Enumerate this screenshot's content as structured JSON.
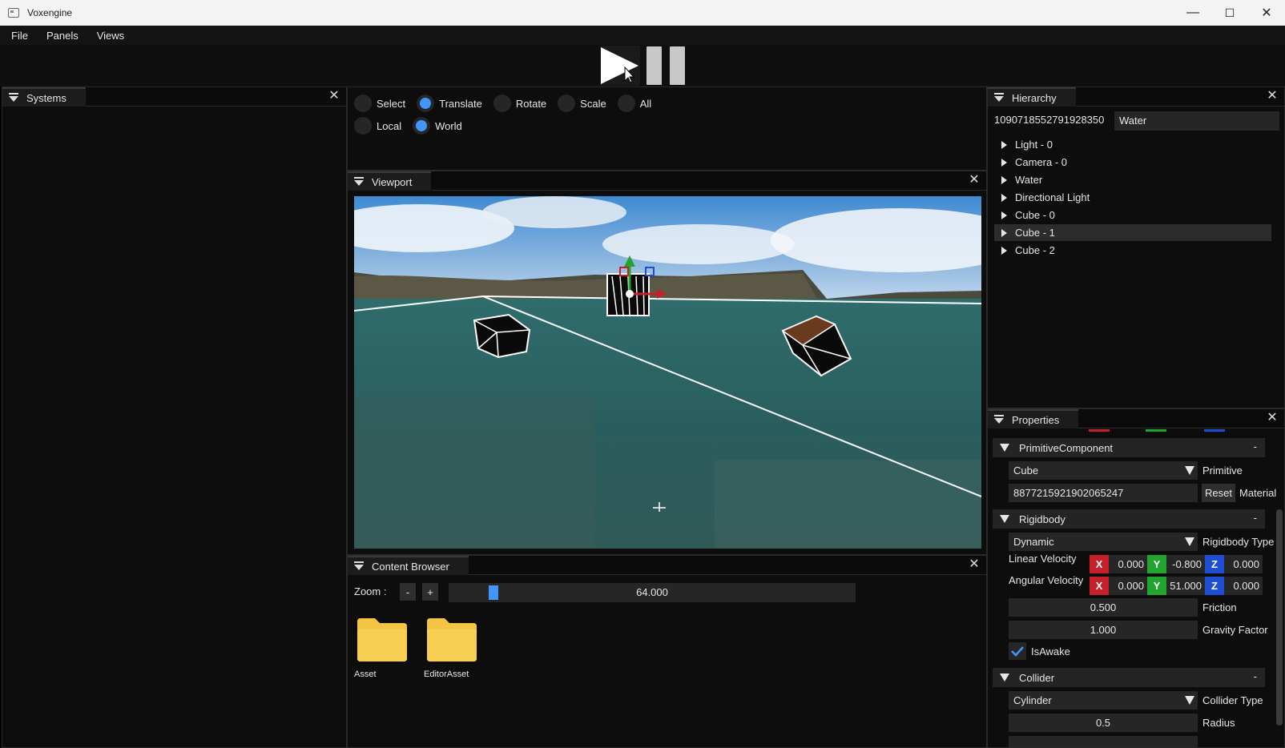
{
  "window": {
    "title": "Voxengine",
    "minimize": "—",
    "maximize": "☐",
    "close": "✕"
  },
  "menu": [
    "File",
    "Panels",
    "Views"
  ],
  "panels": {
    "systems": {
      "title": "Systems"
    },
    "viewport": {
      "title": "Viewport"
    },
    "hierarchy": {
      "title": "Hierarchy"
    },
    "properties": {
      "title": "Properties"
    },
    "content_browser": {
      "title": "Content Browser"
    }
  },
  "gizmo": {
    "operations": [
      {
        "label": "Select",
        "selected": false
      },
      {
        "label": "Translate",
        "selected": true
      },
      {
        "label": "Rotate",
        "selected": false
      },
      {
        "label": "Scale",
        "selected": false
      },
      {
        "label": "All",
        "selected": false
      }
    ],
    "spaces": [
      {
        "label": "Local",
        "selected": false
      },
      {
        "label": "World",
        "selected": true
      }
    ]
  },
  "hierarchy": {
    "entity_id": "1090718552791928350",
    "entity_name": "Water",
    "items": [
      "Light - 0",
      "Camera - 0",
      "Water",
      "Directional Light",
      "Cube - 0",
      "Cube - 1",
      "Cube - 2"
    ],
    "selected": "Cube - 1"
  },
  "properties": {
    "primitive": {
      "title": "PrimitiveComponent",
      "collapse": "-",
      "shape": "Cube",
      "shape_label": "Primitive",
      "material_id": "8877215921902065247",
      "reset": "Reset",
      "material_label": "Material"
    },
    "rigidbody": {
      "title": "Rigidbody",
      "collapse": "-",
      "type": "Dynamic",
      "type_label": "Rigidbody Type",
      "linear_label": "Linear Velocity",
      "linear": {
        "x": "0.000",
        "y": "-0.800",
        "z": "0.000"
      },
      "angular_label": "Angular Velocity",
      "angular": {
        "x": "0.000",
        "y": "51.000",
        "z": "0.000"
      },
      "friction": "0.500",
      "friction_label": "Friction",
      "gravity": "1.000",
      "gravity_label": "Gravity Factor",
      "awake_label": "IsAwake",
      "awake": true
    },
    "collider": {
      "title": "Collider",
      "collapse": "-",
      "type": "Cylinder",
      "type_label": "Collider Type",
      "radius": "0.5",
      "radius_label": "Radius"
    },
    "axes": {
      "x": "X",
      "y": "Y",
      "z": "Z"
    }
  },
  "content_browser": {
    "zoom_label": "Zoom :",
    "zoom_minus": "-",
    "zoom_plus": "+",
    "zoom_value": "64.000",
    "folders": [
      "Asset",
      "EditorAsset"
    ]
  },
  "colors": {
    "accent": "#4296fa",
    "folder": "#f4c542",
    "axis_x": "#c8202a",
    "axis_y": "#22a52e",
    "axis_z": "#1e4ed1"
  }
}
